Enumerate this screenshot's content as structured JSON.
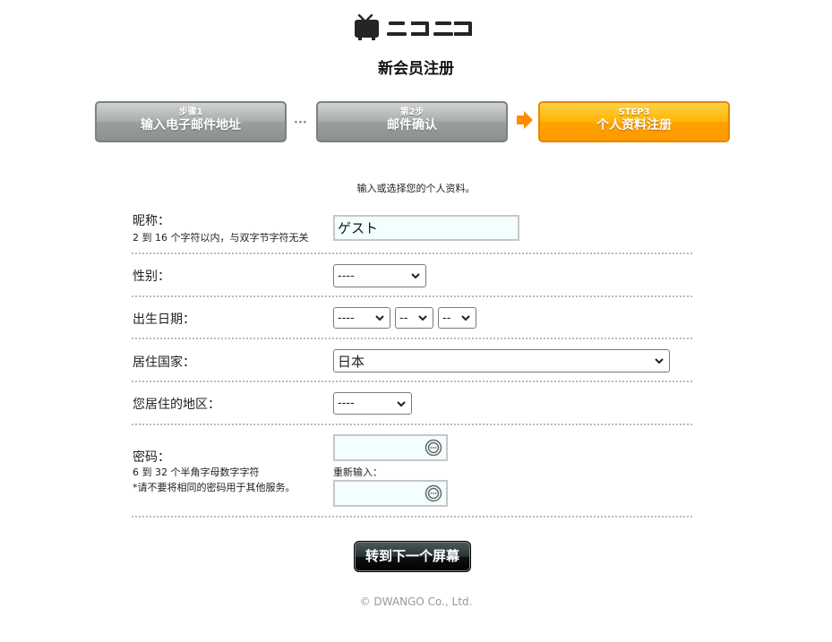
{
  "header": {
    "page_title": "新会员注册"
  },
  "steps": [
    {
      "small": "步骤1",
      "label": "输入电子邮件地址",
      "state": "inactive"
    },
    {
      "small": "第2步",
      "label": "邮件确认",
      "state": "inactive"
    },
    {
      "small": "STEP3",
      "label": "个人资料注册",
      "state": "active"
    }
  ],
  "step_separator_dots": "···",
  "form": {
    "intro": "输入或选择您的个人资料。",
    "nickname": {
      "label": "昵称：",
      "hint": "2 到 16 个字符以内，与双字节字符无关",
      "value": "ゲスト"
    },
    "gender": {
      "label": "性别：",
      "selected": "----"
    },
    "birthday": {
      "label": "出生日期：",
      "year": "----",
      "month": "--",
      "day": "--"
    },
    "country": {
      "label": "居住国家：",
      "selected": "日本"
    },
    "region": {
      "label": "您居住的地区：",
      "selected": "----"
    },
    "password": {
      "label": "密码：",
      "hint1": "6 到 32 个半角字母数字字符",
      "hint2": "*请不要将相同的密码用于其他服务。",
      "reenter_label": "重新输入："
    },
    "submit_label": "转到下一个屏幕"
  },
  "footer": {
    "copyright": "© DWANGO Co., Ltd."
  },
  "colors": {
    "active_step": "#ffb300",
    "inactive_step": "#a9adad",
    "input_bg": "#f3ffff",
    "arrow": "#ff8c00"
  }
}
